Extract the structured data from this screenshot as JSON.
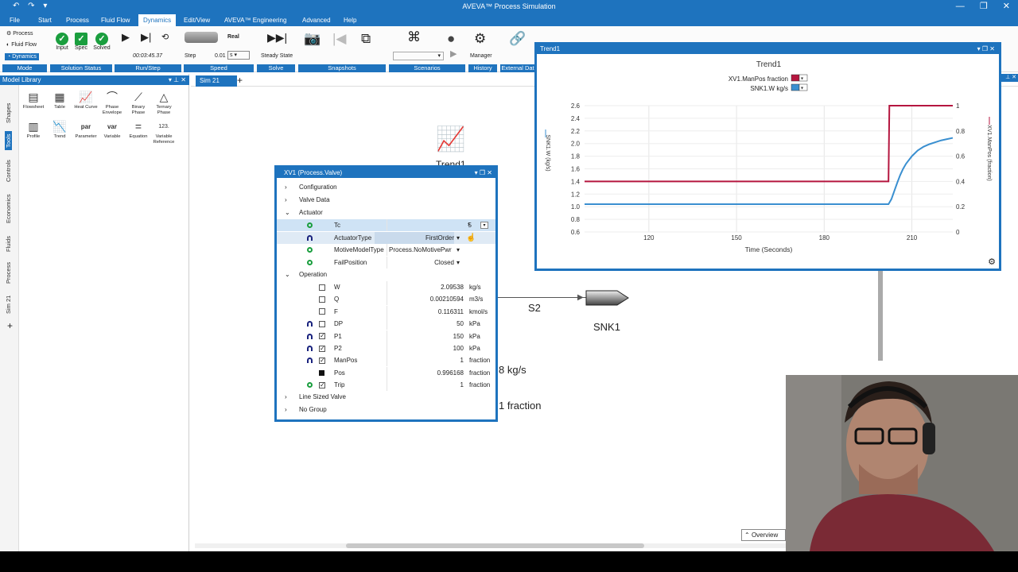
{
  "app": {
    "title": "AVEVA™ Process Simulation",
    "quick_access": "↶ ↷ ▾",
    "window_controls": "— ❐ ✕"
  },
  "menu": [
    "File",
    "Start",
    "Process",
    "Fluid Flow",
    "Dynamics",
    "Edit/View",
    "AVEVA™ Engineering",
    "Advanced",
    "Help"
  ],
  "ribbon": {
    "mode": {
      "label": "Mode",
      "items": [
        "Process",
        "Fluid Flow",
        "Dynamics"
      ]
    },
    "solution": {
      "label": "Solution Status",
      "items": [
        "Input",
        "Spec",
        "Solved"
      ]
    },
    "runstep": {
      "label": "Run/Step",
      "time": "00:03:45.37"
    },
    "speed": {
      "label": "Speed",
      "real": "Real",
      "step": "Step",
      "step_value": "0.01",
      "step_unit": "s"
    },
    "solve": {
      "label": "Solve",
      "steady": "Steady State"
    },
    "snapshots": {
      "label": "Snapshots"
    },
    "scenarios": {
      "label": "Scenarios"
    },
    "history": {
      "label": "History",
      "manager": "Manager"
    },
    "external": {
      "label": "External Dat"
    }
  },
  "library": {
    "title": "Model Library",
    "tabs": [
      "Shapes",
      "Tools",
      "Controls",
      "Economics",
      "Fluids",
      "Process",
      "Sim 21"
    ],
    "tools": [
      {
        "label": "Flowsheet",
        "icon": "flowsheet-icon",
        "glyph": "▤"
      },
      {
        "label": "Table",
        "icon": "table-icon",
        "glyph": "▦"
      },
      {
        "label": "Heat Curve",
        "icon": "heat-curve-icon",
        "glyph": "📈"
      },
      {
        "label": "Phase Envelope",
        "icon": "phase-envelope-icon",
        "glyph": "⌒"
      },
      {
        "label": "Binary Phase",
        "icon": "binary-phase-icon",
        "glyph": "⟋"
      },
      {
        "label": "Ternary Phase",
        "icon": "ternary-phase-icon",
        "glyph": "△"
      },
      {
        "label": "Profile",
        "icon": "profile-icon",
        "glyph": "▥"
      },
      {
        "label": "Trend",
        "icon": "trend-icon",
        "glyph": "📉"
      },
      {
        "label": "Parameter",
        "icon": "parameter-icon",
        "glyph": "par"
      },
      {
        "label": "Variable",
        "icon": "variable-icon",
        "glyph": "var"
      },
      {
        "label": "Equation",
        "icon": "equation-icon",
        "glyph": "="
      },
      {
        "label": "Variable Reference",
        "icon": "variable-reference-icon",
        "glyph": "123."
      }
    ]
  },
  "canvas": {
    "tab": "Sim 21",
    "add": "+",
    "trend_label": "Trend1",
    "s2": "S2",
    "snk1": "SNK1",
    "w_val": "8 kg/s",
    "pos_val": "1 fraction",
    "overview": "Overview"
  },
  "valve": {
    "title": "XV1 (Process.Valve)",
    "sections": {
      "config": "Configuration",
      "valve_data": "Valve Data",
      "actuator": "Actuator",
      "operation": "Operation",
      "line_sized": "Line Sized Valve",
      "no_group": "No Group"
    },
    "actuator": [
      {
        "name": "Tc",
        "value": "5",
        "unit": "s"
      },
      {
        "name": "ActuatorType",
        "value": "FirstOrder"
      },
      {
        "name": "MotiveModelType",
        "value": "Process.NoMotivePwr"
      },
      {
        "name": "FailPosition",
        "value": "Closed"
      }
    ],
    "operation": [
      {
        "name": "W",
        "value": "2.09538",
        "unit": "kg/s",
        "dot": "",
        "check": "empty"
      },
      {
        "name": "Q",
        "value": "0.00210594",
        "unit": "m3/s",
        "dot": "",
        "check": "empty"
      },
      {
        "name": "F",
        "value": "0.116311",
        "unit": "kmol/s",
        "dot": "",
        "check": "empty"
      },
      {
        "name": "DP",
        "value": "50",
        "unit": "kPa",
        "dot": "b",
        "check": "empty"
      },
      {
        "name": "P1",
        "value": "150",
        "unit": "kPa",
        "dot": "b",
        "check": "checked"
      },
      {
        "name": "P2",
        "value": "100",
        "unit": "kPa",
        "dot": "b",
        "check": "checked"
      },
      {
        "name": "ManPos",
        "value": "1",
        "unit": "fraction",
        "dot": "b",
        "check": "checked"
      },
      {
        "name": "Pos",
        "value": "0.996168",
        "unit": "fraction",
        "dot": "",
        "check": "square"
      },
      {
        "name": "Trip",
        "value": "1",
        "unit": "fraction",
        "dot": "g",
        "check": "checked"
      }
    ]
  },
  "trend": {
    "window_title": "Trend1",
    "controls": "▾ ❐ ✕",
    "settings": "⚙"
  },
  "chart_data": {
    "type": "line",
    "title": "Trend1",
    "xlabel": "Time (Seconds)",
    "ylabel": "SNK1.W (kg/s)",
    "y2label": "XV1.ManPos (fraction)",
    "xlim": [
      98,
      224
    ],
    "ylim": [
      0.6,
      2.6
    ],
    "y2lim": [
      0,
      1
    ],
    "xticks": [
      120,
      150,
      180,
      210
    ],
    "yticks": [
      "0.6",
      "0.8",
      "1.0",
      "1.2",
      "1.4",
      "1.6",
      "1.8",
      "2.0",
      "2.2",
      "2.4",
      "2.6"
    ],
    "y2ticks": [
      "0",
      "0.2",
      "0.4",
      "0.6",
      "0.8",
      "1"
    ],
    "grid": true,
    "legend_position": "top-center",
    "series": [
      {
        "name": "XV1.ManPos fraction",
        "color": "#b5163f",
        "axis": "right",
        "x": [
          98,
          202,
          202.3,
          224
        ],
        "y": [
          0.4,
          0.4,
          1,
          1
        ]
      },
      {
        "name": "SNK1.W kg/s",
        "color": "#3a8fd0",
        "axis": "left",
        "x": [
          98,
          202,
          203,
          204,
          205,
          206,
          207,
          208,
          210,
          212,
          214,
          216,
          218,
          220,
          222,
          224
        ],
        "y": [
          1.04,
          1.04,
          1.12,
          1.25,
          1.38,
          1.5,
          1.6,
          1.68,
          1.8,
          1.89,
          1.95,
          1.99,
          2.02,
          2.05,
          2.07,
          2.09
        ]
      }
    ]
  }
}
